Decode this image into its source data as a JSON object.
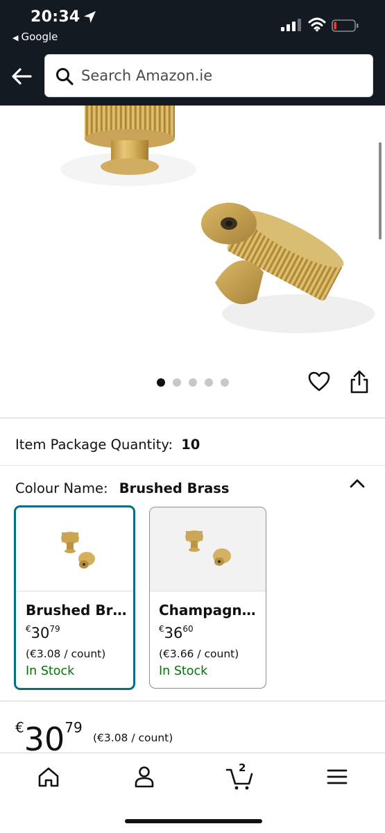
{
  "status_bar": {
    "time": "20:34",
    "back_app": "Google",
    "battery_level": 0.12,
    "signal_bars": 3
  },
  "header": {
    "search_placeholder": "Search Amazon.ie"
  },
  "gallery": {
    "image_count": 5,
    "active_index": 0
  },
  "details": {
    "package_qty_label": "Item Package Quantity:",
    "package_qty_value": "10",
    "colour_label": "Colour Name:",
    "colour_value": "Brushed Brass"
  },
  "swatches": [
    {
      "name": "Brushed Br…",
      "currency": "€",
      "price_whole": "30",
      "price_cents": "79",
      "unit_price": "(€3.08 / count)",
      "stock": "In Stock",
      "selected": true
    },
    {
      "name": "Champagn…",
      "currency": "€",
      "price_whole": "36",
      "price_cents": "60",
      "unit_price": "(€3.66 / count)",
      "stock": "In Stock",
      "selected": false
    }
  ],
  "price": {
    "currency": "€",
    "whole": "30",
    "cents": "79",
    "unit_price": "(€3.08 / count)"
  },
  "bottom_nav": {
    "cart_count": "2"
  },
  "colors": {
    "header_bg": "#131a22",
    "selected_border": "#007185",
    "in_stock": "#007600"
  }
}
